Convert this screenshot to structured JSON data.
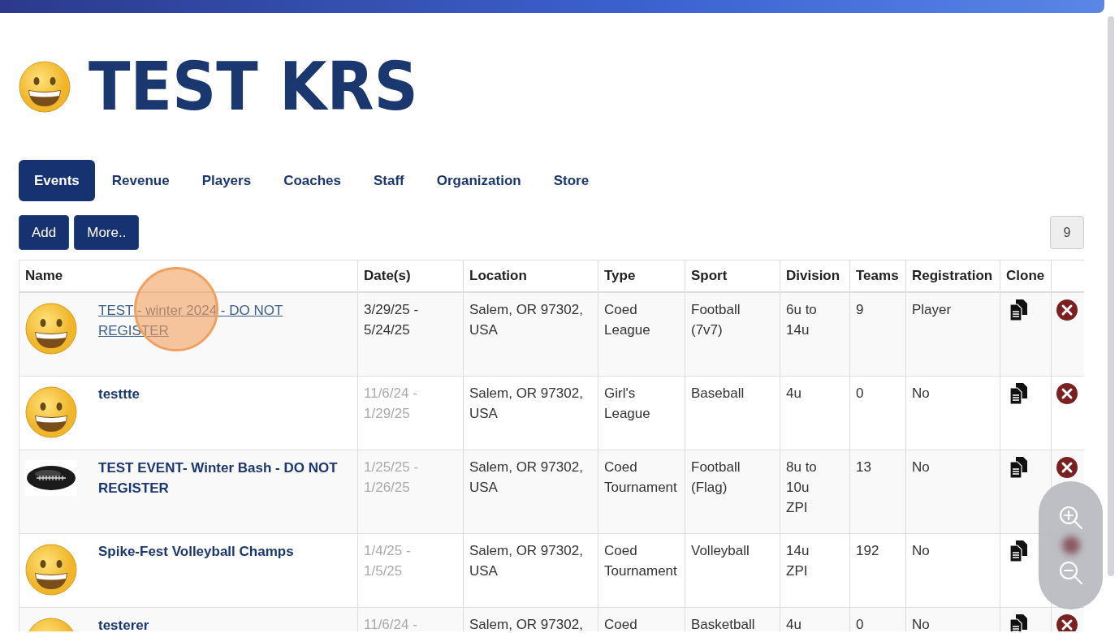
{
  "header": {
    "title": "TEST KRS"
  },
  "tabs": [
    {
      "label": "Events",
      "selected": true
    },
    {
      "label": "Revenue",
      "selected": false
    },
    {
      "label": "Players",
      "selected": false
    },
    {
      "label": "Coaches",
      "selected": false
    },
    {
      "label": "Staff",
      "selected": false
    },
    {
      "label": "Organization",
      "selected": false
    },
    {
      "label": "Store",
      "selected": false
    }
  ],
  "actions": [
    "Add",
    "More.."
  ],
  "count": "9",
  "table": {
    "columns": [
      "Name",
      "Date(s)",
      "Location",
      "Type",
      "Sport",
      "Division",
      "Teams",
      "Registration",
      "Clone"
    ],
    "rows": [
      {
        "kind": "emoji",
        "delete_visible": true,
        "name": "TEST - winter 2024 - DO NOT REGISTER",
        "hovered": true,
        "dates": "3/29/25 -\n5/24/25",
        "past": false,
        "location": "Salem, OR 97302,\nUSA",
        "type": "Coed\nLeague",
        "sport": "Football\n(7v7)",
        "division": "6u to\n14u",
        "teams": "9",
        "registration": "Player"
      },
      {
        "kind": "emoji",
        "delete_visible": true,
        "name": "testtte",
        "hovered": false,
        "dates": "11/6/24 -\n1/29/25",
        "past": true,
        "location": "Salem, OR 97302,\nUSA",
        "type": "Girl's\nLeague",
        "sport": "Baseball",
        "division": "4u",
        "teams": "0",
        "registration": "No"
      },
      {
        "kind": "picture",
        "delete_visible": true,
        "name": "TEST EVENT- Winter Bash - DO NOT REGISTER",
        "hovered": false,
        "dates": "1/25/25 -\n1/26/25",
        "past": true,
        "location": "Salem, OR 97302,\nUSA",
        "type": "Coed\nTournament",
        "sport": "Football\n(Flag)",
        "division": "8u to\n10u\nZPI",
        "teams": "13",
        "registration": "No"
      },
      {
        "kind": "emoji",
        "delete_visible": false,
        "name": "Spike-Fest Volleyball Champs",
        "hovered": false,
        "dates": "1/4/25 -\n1/5/25",
        "past": true,
        "location": "Salem, OR 97302,\nUSA",
        "type": "Coed\nTournament",
        "sport": "Volleyball",
        "division": "14u\nZPI",
        "teams": "192",
        "registration": "No"
      },
      {
        "kind": "emoji",
        "delete_visible": true,
        "name": "testerer",
        "hovered": false,
        "dates": "11/6/24 -",
        "past": true,
        "location": "Salem, OR 97302,",
        "type": "Coed",
        "sport": "Basketball",
        "division": "4u",
        "teams": "0",
        "registration": "No"
      }
    ]
  }
}
